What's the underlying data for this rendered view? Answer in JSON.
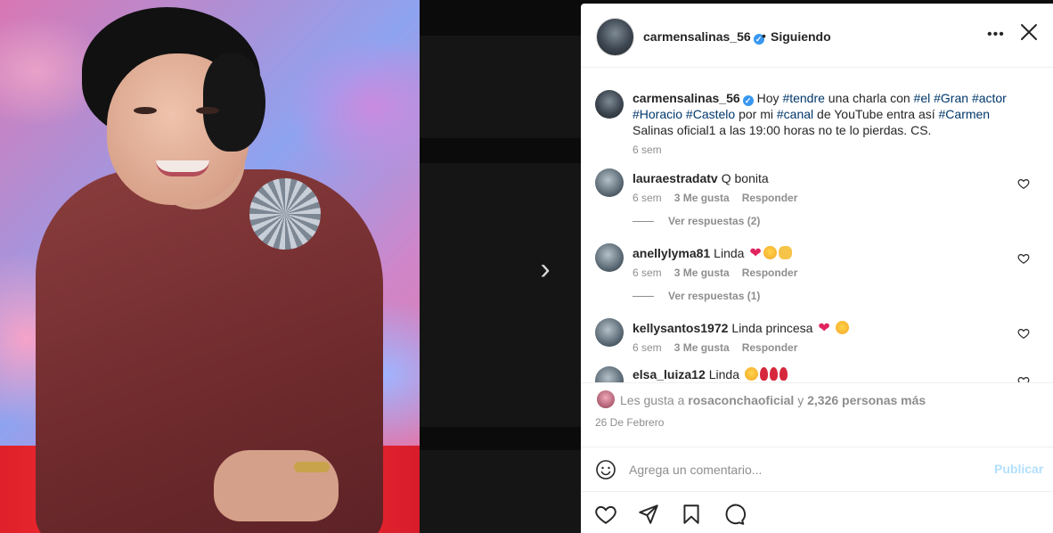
{
  "post": {
    "author": "carmensalinas_56",
    "dot": "•",
    "follow_status": "Siguiendo",
    "more_icon": "more-horizontal-icon",
    "close_icon": "close-icon"
  },
  "caption": {
    "username": "carmensalinas_56",
    "parts": [
      {
        "text": "Hoy ",
        "tag": false
      },
      {
        "text": "#tendre",
        "tag": true
      },
      {
        "text": " una charla con ",
        "tag": false
      },
      {
        "text": "#el",
        "tag": true
      },
      {
        "text": " ",
        "tag": false
      },
      {
        "text": "#Gran",
        "tag": true
      },
      {
        "text": " ",
        "tag": false
      },
      {
        "text": "#actor",
        "tag": true
      },
      {
        "text": " ",
        "tag": false
      },
      {
        "text": "#Horacio",
        "tag": true
      },
      {
        "text": " ",
        "tag": false
      },
      {
        "text": "#Castelo",
        "tag": true
      },
      {
        "text": " por mi ",
        "tag": false
      },
      {
        "text": "#canal",
        "tag": true
      },
      {
        "text": " de YouTube entra así ",
        "tag": false
      },
      {
        "text": "#Carmen",
        "tag": true
      },
      {
        "text": " Salinas oficial1 a las 19:00 horas no te lo pierdas. CS.",
        "tag": false
      }
    ],
    "time": "6 sem"
  },
  "comments": [
    {
      "username": "lauraestradatv",
      "text": "Q bonita",
      "time": "6 sem",
      "likes": "3 Me gusta",
      "reply": "Responder",
      "replies": "Ver respuestas (2)"
    },
    {
      "username": "anellylyma81",
      "text": "Linda",
      "time": "6 sem",
      "likes": "3 Me gusta",
      "reply": "Responder",
      "replies": "Ver respuestas (1)"
    },
    {
      "username": "kellysantos1972",
      "text": "Linda princesa",
      "time": "6 sem",
      "likes": "3 Me gusta",
      "reply": "Responder"
    },
    {
      "username": "elsa_luiza12",
      "text": "Linda"
    }
  ],
  "likes": {
    "prefix": "Les gusta a",
    "first_liker": "rosaconchaoficial",
    "joiner": "y",
    "others": "2,326 personas más"
  },
  "date": "26 De Febrero",
  "composer": {
    "placeholder": "Agrega un comentario...",
    "publish_label": "Publicar"
  },
  "colors": {
    "accent": "#3897f0",
    "hashtag": "#00376b",
    "muted": "#8e8e8e",
    "publish_disabled": "#b2dffc"
  }
}
